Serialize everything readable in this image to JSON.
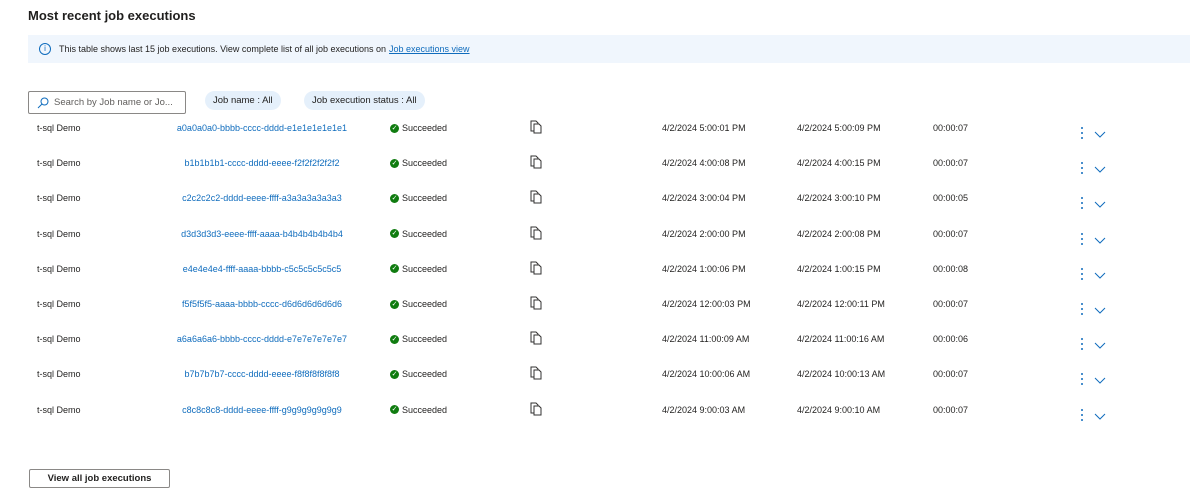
{
  "title": "Most recent job executions",
  "banner": {
    "text": "This table shows last 15 job executions. View complete list of all job executions on",
    "link": "Job executions view"
  },
  "search": {
    "placeholder": "Search by Job name or Jo..."
  },
  "filters": [
    {
      "label": "Job name : All"
    },
    {
      "label": "Job execution status : All"
    }
  ],
  "rows": [
    {
      "name": "t-sql Demo",
      "id": "a0a0a0a0-bbbb-cccc-dddd-e1e1e1e1e1e1",
      "status": "Succeeded",
      "start": "4/2/2024 5:00:01 PM",
      "end": "4/2/2024 5:00:09 PM",
      "duration": "00:00:07"
    },
    {
      "name": "t-sql Demo",
      "id": "b1b1b1b1-cccc-dddd-eeee-f2f2f2f2f2f2",
      "status": "Succeeded",
      "start": "4/2/2024 4:00:08 PM",
      "end": "4/2/2024 4:00:15 PM",
      "duration": "00:00:07"
    },
    {
      "name": "t-sql Demo",
      "id": "c2c2c2c2-dddd-eeee-ffff-a3a3a3a3a3a3",
      "status": "Succeeded",
      "start": "4/2/2024 3:00:04 PM",
      "end": "4/2/2024 3:00:10 PM",
      "duration": "00:00:05"
    },
    {
      "name": "t-sql Demo",
      "id": "d3d3d3d3-eeee-ffff-aaaa-b4b4b4b4b4b4",
      "status": "Succeeded",
      "start": "4/2/2024 2:00:00 PM",
      "end": "4/2/2024 2:00:08 PM",
      "duration": "00:00:07"
    },
    {
      "name": "t-sql Demo",
      "id": "e4e4e4e4-ffff-aaaa-bbbb-c5c5c5c5c5c5",
      "status": "Succeeded",
      "start": "4/2/2024 1:00:06 PM",
      "end": "4/2/2024 1:00:15 PM",
      "duration": "00:00:08"
    },
    {
      "name": "t-sql Demo",
      "id": "f5f5f5f5-aaaa-bbbb-cccc-d6d6d6d6d6d6",
      "status": "Succeeded",
      "start": "4/2/2024 12:00:03 PM",
      "end": "4/2/2024 12:00:11 PM",
      "duration": "00:00:07"
    },
    {
      "name": "t-sql Demo",
      "id": "a6a6a6a6-bbbb-cccc-dddd-e7e7e7e7e7e7",
      "status": "Succeeded",
      "start": "4/2/2024 11:00:09 AM",
      "end": "4/2/2024 11:00:16 AM",
      "duration": "00:00:06"
    },
    {
      "name": "t-sql Demo",
      "id": "b7b7b7b7-cccc-dddd-eeee-f8f8f8f8f8f8",
      "status": "Succeeded",
      "start": "4/2/2024 10:00:06 AM",
      "end": "4/2/2024 10:00:13 AM",
      "duration": "00:00:07"
    },
    {
      "name": "t-sql Demo",
      "id": "c8c8c8c8-dddd-eeee-ffff-g9g9g9g9g9g9",
      "status": "Succeeded",
      "start": "4/2/2024 9:00:03 AM",
      "end": "4/2/2024 9:00:10 AM",
      "duration": "00:00:07"
    }
  ],
  "icons": {
    "status": "check-circle-icon",
    "copy": "copy-icon",
    "more": "more-vertical-icon",
    "expand": "chevron-down-icon"
  },
  "colors": {
    "accent": "#0f6cbd",
    "success": "#107c10",
    "banner_bg": "#f0f6fd"
  },
  "view_all_label": "View all job executions"
}
